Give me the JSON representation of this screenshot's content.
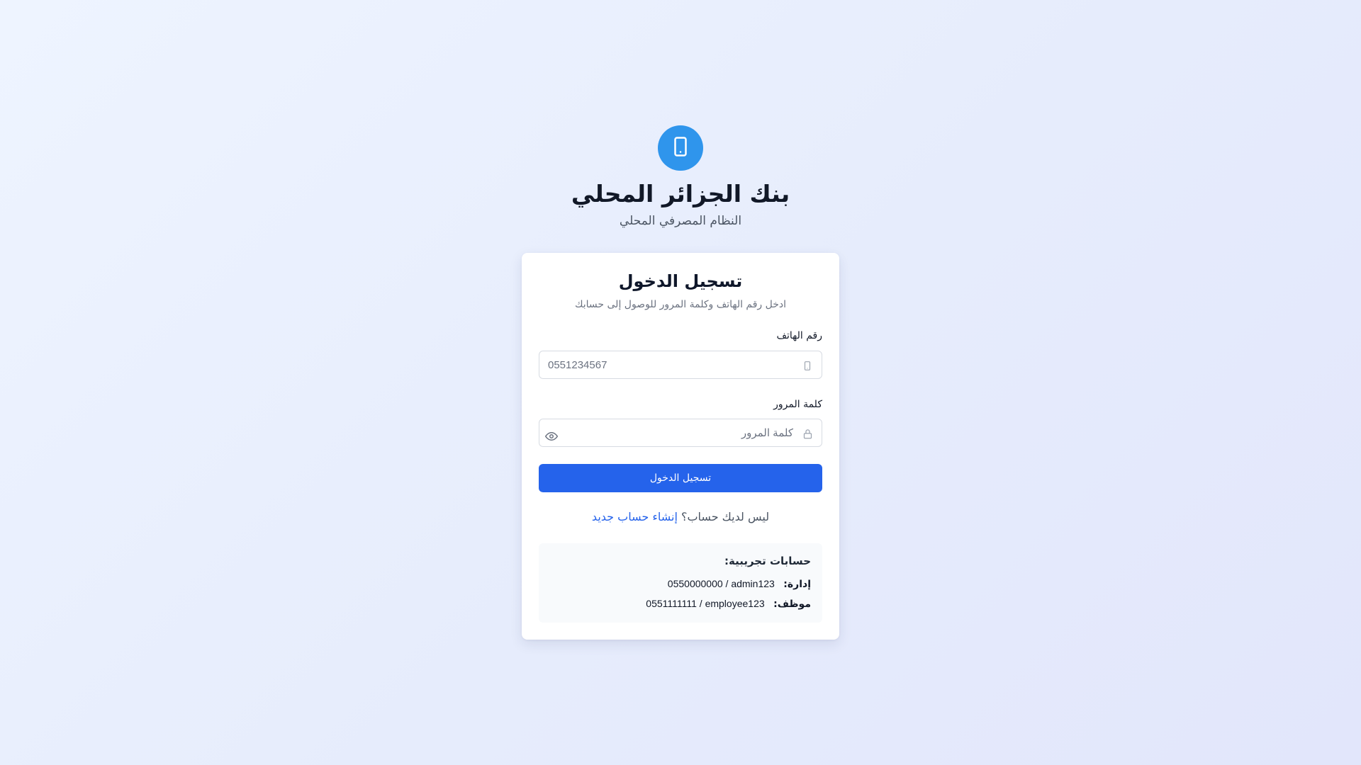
{
  "brand": {
    "icon": "smartphone-icon",
    "title": "بنك الجزائر المحلي",
    "subtitle": "النظام المصرفي المحلي",
    "color": "#2f95ec"
  },
  "login_card": {
    "title": "تسجيل الدخول",
    "subtitle": "ادخل رقم الهاتف وكلمة المرور للوصول إلى حسابك",
    "phone": {
      "label": "رقم الهاتف",
      "placeholder": "0551234567",
      "value": "",
      "icon": "smartphone-icon"
    },
    "password": {
      "label": "كلمة المرور",
      "placeholder": "كلمة المرور",
      "value": "",
      "icon": "lock-icon",
      "toggle_icon": "eye-icon"
    },
    "submit_label": "تسجيل الدخول",
    "submit_color": "#2563eb",
    "signup": {
      "prompt": "ليس لديك حساب؟",
      "link_label": "إنشاء حساب جديد"
    },
    "demo": {
      "title": "حسابات تجريبية:",
      "accounts": [
        {
          "role": "إدارة:",
          "credentials": "0550000000 / admin123"
        },
        {
          "role": "موظف:",
          "credentials": "0551111111 / employee123"
        }
      ]
    }
  }
}
